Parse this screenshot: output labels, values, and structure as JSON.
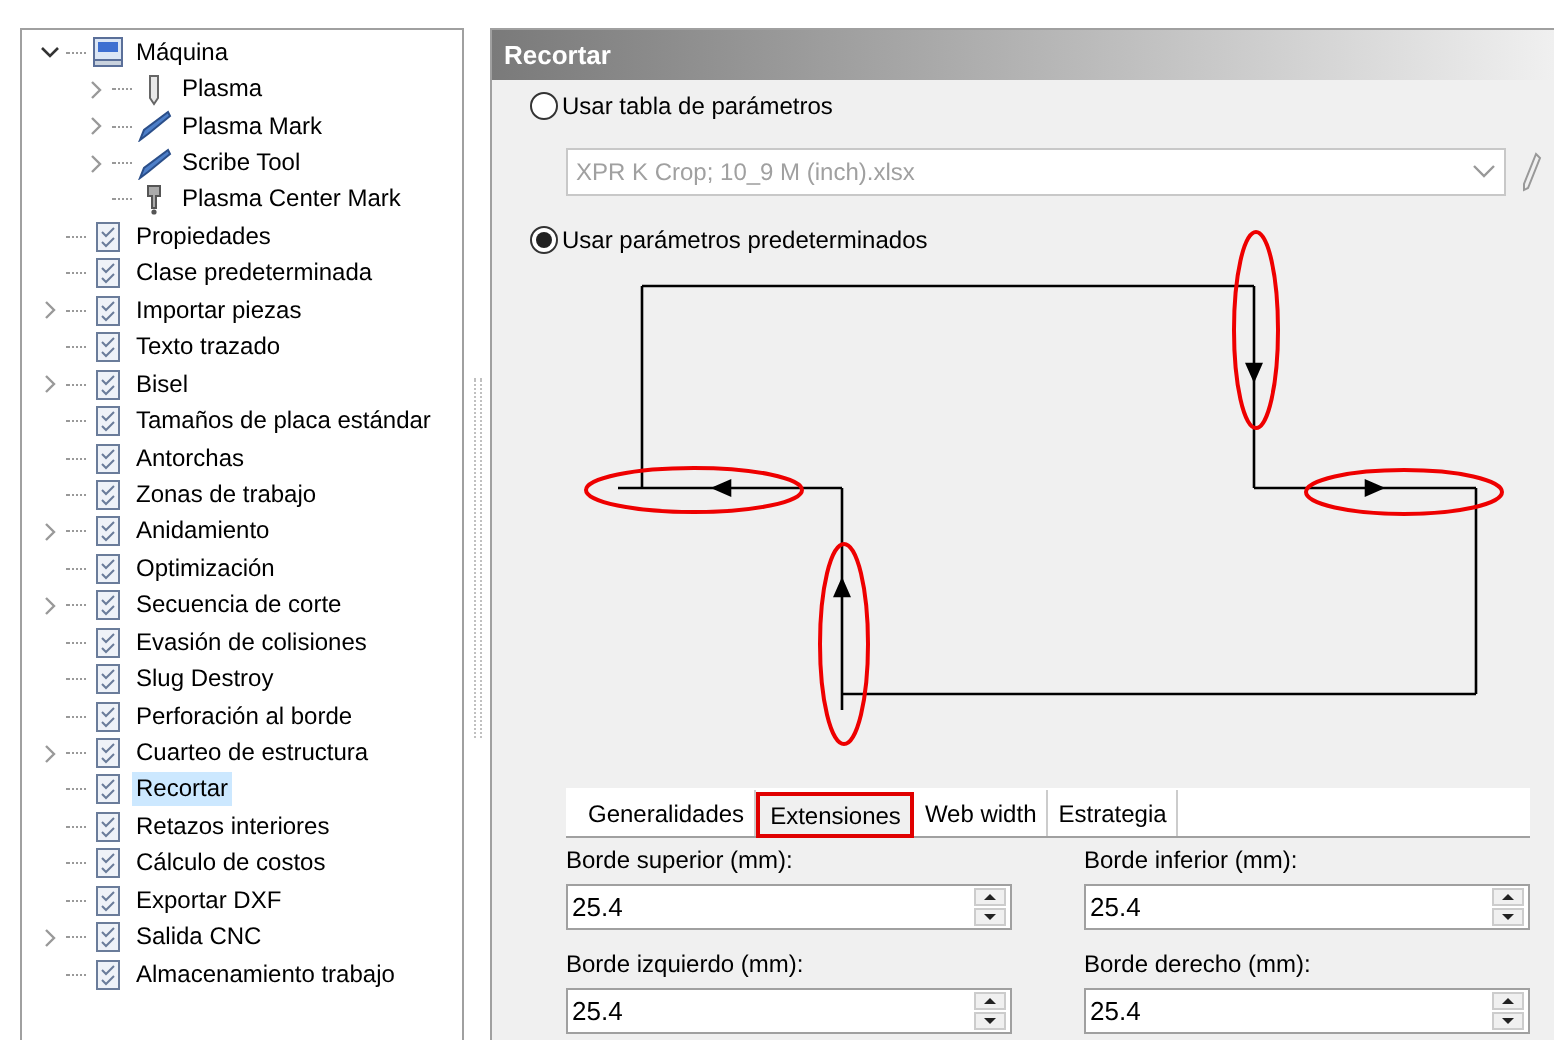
{
  "tree": [
    {
      "label": "Máquina",
      "kind": "machine",
      "expanded": true,
      "selected": false,
      "children": [
        {
          "label": "Plasma",
          "kind": "torch",
          "expanded": false,
          "selected": false
        },
        {
          "label": "Plasma Mark",
          "kind": "pen",
          "expanded": false,
          "selected": false
        },
        {
          "label": "Scribe Tool",
          "kind": "pen",
          "expanded": false,
          "selected": false
        },
        {
          "label": "Plasma Center Mark",
          "kind": "punch",
          "selected": false
        }
      ]
    },
    {
      "label": "Propiedades",
      "kind": "page",
      "selected": false
    },
    {
      "label": "Clase predeterminada",
      "kind": "page",
      "selected": false
    },
    {
      "label": "Importar piezas",
      "kind": "page",
      "expanded": false,
      "selected": false
    },
    {
      "label": "Texto trazado",
      "kind": "page",
      "selected": false
    },
    {
      "label": "Bisel",
      "kind": "page",
      "expanded": false,
      "selected": false
    },
    {
      "label": "Tamaños de placa estándar",
      "kind": "page",
      "selected": false
    },
    {
      "label": "Antorchas",
      "kind": "page",
      "selected": false
    },
    {
      "label": "Zonas de trabajo",
      "kind": "page",
      "selected": false
    },
    {
      "label": "Anidamiento",
      "kind": "page",
      "expanded": false,
      "selected": false
    },
    {
      "label": "Optimización",
      "kind": "page",
      "selected": false
    },
    {
      "label": "Secuencia de corte",
      "kind": "page",
      "expanded": false,
      "selected": false
    },
    {
      "label": "Evasión de colisiones",
      "kind": "page",
      "selected": false
    },
    {
      "label": "Slug Destroy",
      "kind": "page",
      "selected": false
    },
    {
      "label": "Perforación al borde",
      "kind": "page",
      "selected": false
    },
    {
      "label": "Cuarteo de estructura",
      "kind": "page",
      "expanded": false,
      "selected": false
    },
    {
      "label": "Recortar",
      "kind": "page",
      "selected": true
    },
    {
      "label": "Retazos interiores",
      "kind": "page",
      "selected": false
    },
    {
      "label": "Cálculo de costos",
      "kind": "page",
      "selected": false
    },
    {
      "label": "Exportar DXF",
      "kind": "page",
      "selected": false
    },
    {
      "label": "Salida CNC",
      "kind": "page",
      "expanded": false,
      "selected": false
    },
    {
      "label": "Almacenamiento trabajo",
      "kind": "page",
      "selected": false
    }
  ],
  "panel": {
    "title": "Recortar",
    "options": [
      {
        "label": "Usar tabla de parámetros",
        "selected": false
      },
      {
        "label": "Usar parámetros predeterminados",
        "selected": true
      }
    ],
    "table_file": {
      "value": "XPR K Crop; 10_9 M (inch).xlsx",
      "disabled": true
    },
    "tabs": [
      {
        "label": "Generalidades",
        "selected": false
      },
      {
        "label": "Extensiones",
        "selected": true
      },
      {
        "label": "Web width",
        "selected": false
      },
      {
        "label": "Estrategia",
        "selected": false
      }
    ],
    "fields": [
      {
        "label": "Borde superior (mm):",
        "value": "25.4"
      },
      {
        "label": "Borde inferior (mm):",
        "value": "25.4"
      },
      {
        "label": "Borde izquierdo (mm):",
        "value": "25.4"
      },
      {
        "label": "Borde derecho (mm):",
        "value": "25.4"
      }
    ]
  }
}
